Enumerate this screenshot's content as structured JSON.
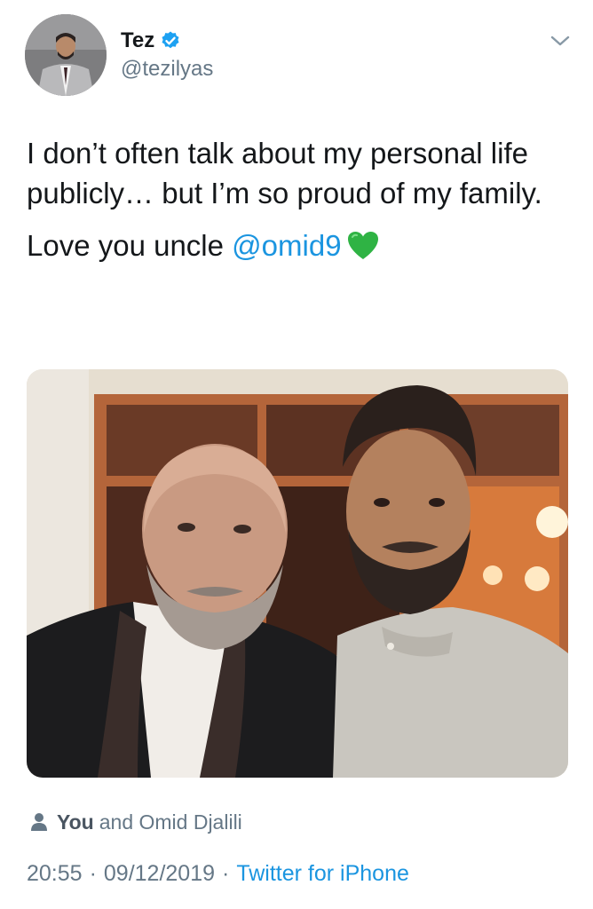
{
  "author": {
    "display_name": "Tez",
    "handle": "@tezilyas",
    "verified": true
  },
  "tweet": {
    "paragraph1": "I don’t often talk about my personal life publicly… but I’m so proud of my family.",
    "paragraph2_prefix": "Love you uncle ",
    "mention": "@omid9",
    "emoji": "green-heart"
  },
  "media": {
    "type": "photo",
    "description_icon": "photo"
  },
  "tags": {
    "you_label": "You",
    "rest": "and Omid Djalili"
  },
  "meta": {
    "time": "20:55",
    "date": "09/12/2019",
    "separator": "·",
    "source": "Twitter for iPhone"
  },
  "colors": {
    "link": "#1b95e0",
    "secondary_text": "#657786",
    "primary_text": "#14171a",
    "heart": "#2fb344"
  }
}
